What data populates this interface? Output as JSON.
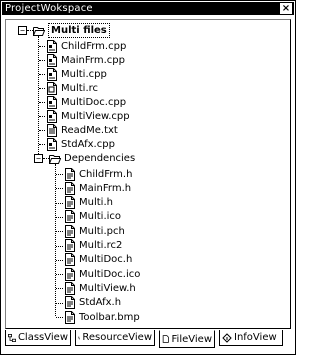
{
  "window": {
    "title": "ProjectWokspace",
    "close_glyph": "×"
  },
  "tree": {
    "root": {
      "label": "Multi files",
      "icon": "folder-open-icon",
      "expander": "−"
    },
    "files": [
      {
        "label": "ChildFrm.cpp",
        "icon": "cpp-file-icon"
      },
      {
        "label": "MainFrm.cpp",
        "icon": "cpp-file-icon"
      },
      {
        "label": "Multi.cpp",
        "icon": "cpp-file-icon"
      },
      {
        "label": "Multi.rc",
        "icon": "rc-file-icon"
      },
      {
        "label": "MultiDoc.cpp",
        "icon": "cpp-file-icon"
      },
      {
        "label": "MultiView.cpp",
        "icon": "cpp-file-icon"
      },
      {
        "label": "ReadMe.txt",
        "icon": "text-file-icon"
      },
      {
        "label": "StdAfx.cpp",
        "icon": "cpp-file-icon"
      }
    ],
    "dependencies": {
      "label": "Dependencies",
      "icon": "folder-open-icon",
      "expander": "−",
      "items": [
        {
          "label": "ChildFrm.h",
          "icon": "header-file-icon"
        },
        {
          "label": "MainFrm.h",
          "icon": "header-file-icon"
        },
        {
          "label": "Multi.h",
          "icon": "header-file-icon"
        },
        {
          "label": "Multi.ico",
          "icon": "header-file-icon"
        },
        {
          "label": "Multi.pch",
          "icon": "header-file-icon"
        },
        {
          "label": "Multi.rc2",
          "icon": "header-file-icon"
        },
        {
          "label": "MultiDoc.h",
          "icon": "header-file-icon"
        },
        {
          "label": "MultiDoc.ico",
          "icon": "header-file-icon"
        },
        {
          "label": "MultiView.h",
          "icon": "header-file-icon"
        },
        {
          "label": "StdAfx.h",
          "icon": "header-file-icon"
        },
        {
          "label": "Toolbar.bmp",
          "icon": "header-file-icon"
        }
      ]
    }
  },
  "tabs": [
    {
      "label": "ClassView",
      "icon": "class-icon",
      "active": false
    },
    {
      "label": "ResourceView",
      "icon": "resource-icon",
      "active": false
    },
    {
      "label": "FileView",
      "icon": "file-icon",
      "active": true
    },
    {
      "label": "InfoView",
      "icon": "info-icon",
      "active": false
    }
  ]
}
